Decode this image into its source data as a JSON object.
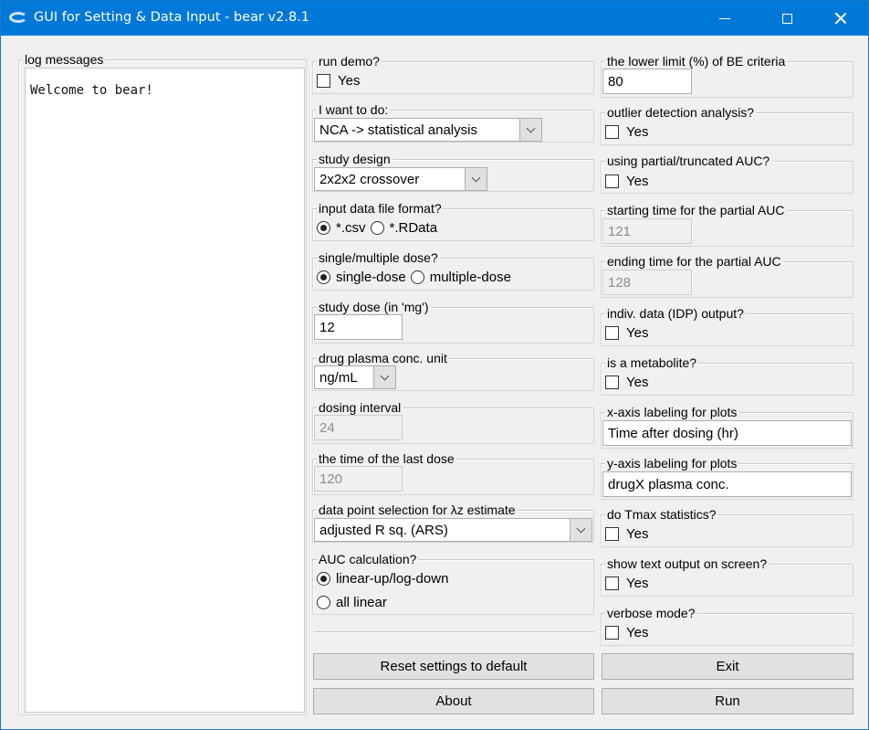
{
  "window": {
    "title": "GUI for Setting & Data Input - bear v2.8.1",
    "controls": [
      "minimize",
      "maximize",
      "close"
    ]
  },
  "log": {
    "label": "log messages",
    "text": "Welcome to bear!"
  },
  "middle": {
    "run_demo": {
      "label": "run demo?",
      "checkbox_label": "Yes",
      "checked": false
    },
    "i_want_to_do": {
      "label": "I want to do:",
      "selected": "NCA -> statistical analysis"
    },
    "study_design": {
      "label": "study design",
      "selected": "2x2x2 crossover"
    },
    "input_format": {
      "label": "input data file format?",
      "options": [
        {
          "label": "*.csv",
          "selected": true
        },
        {
          "label": "*.RData",
          "selected": false
        }
      ]
    },
    "dose_type": {
      "label": "single/multiple dose?",
      "options": [
        {
          "label": "single-dose",
          "selected": true
        },
        {
          "label": "multiple-dose",
          "selected": false
        }
      ]
    },
    "study_dose": {
      "label": "study dose (in 'mg')",
      "value": "12"
    },
    "conc_unit": {
      "label": "drug plasma conc. unit",
      "selected": "ng/mL"
    },
    "dosing_interval": {
      "label": "dosing interval",
      "value": "24",
      "disabled": true
    },
    "last_dose_time": {
      "label": "the time of the last dose",
      "value": "120",
      "disabled": true
    },
    "lambda_z": {
      "label": "data point selection for λz estimate",
      "selected": "adjusted R sq. (ARS)"
    },
    "auc_calc": {
      "label": "AUC calculation?",
      "options": [
        {
          "label": "linear-up/log-down",
          "selected": true
        },
        {
          "label": "all linear",
          "selected": false
        }
      ]
    }
  },
  "right": {
    "be_lower_limit": {
      "label": "the lower limit (%) of BE criteria",
      "value": "80"
    },
    "outlier": {
      "label": "outlier detection analysis?",
      "checkbox_label": "Yes",
      "checked": false
    },
    "partial_auc": {
      "label": "using partial/truncated AUC?",
      "checkbox_label": "Yes",
      "checked": false
    },
    "partial_start": {
      "label": "starting time for the partial AUC",
      "value": "121",
      "disabled": true
    },
    "partial_end": {
      "label": "ending time for the partial AUC",
      "value": "128",
      "disabled": true
    },
    "idp_output": {
      "label": "indiv. data (IDP) output?",
      "checkbox_label": "Yes",
      "checked": false
    },
    "metabolite": {
      "label": "is a metabolite?",
      "checkbox_label": "Yes",
      "checked": false
    },
    "x_label": {
      "label": "x-axis labeling for plots",
      "value": "Time after dosing (hr)"
    },
    "y_label": {
      "label": "y-axis labeling for plots",
      "value": "drugX plasma conc."
    },
    "tmax_stats": {
      "label": "do Tmax statistics?",
      "checkbox_label": "Yes",
      "checked": false
    },
    "text_output": {
      "label": "show text output on screen?",
      "checkbox_label": "Yes",
      "checked": false
    },
    "verbose": {
      "label": "verbose mode?",
      "checkbox_label": "Yes",
      "checked": false
    }
  },
  "buttons": {
    "reset": "Reset settings to default",
    "exit": "Exit",
    "about": "About",
    "run": "Run"
  },
  "colors": {
    "titlebar": "#0078d7",
    "window_bg": "#f0f0f0",
    "button_bg": "#e1e1e1"
  }
}
